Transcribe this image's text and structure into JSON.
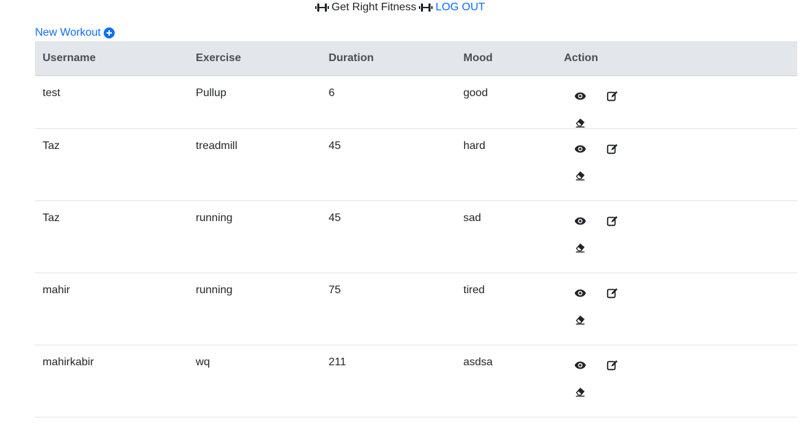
{
  "header": {
    "brand": "Get Right Fitness",
    "logout_label": "LOG OUT"
  },
  "toolbar": {
    "new_workout_label": "New Workout"
  },
  "table": {
    "columns": [
      "Username",
      "Exercise",
      "Duration",
      "Mood",
      "Action"
    ],
    "rows": [
      {
        "username": "test",
        "exercise": "Pullup",
        "duration": "6",
        "mood": "good"
      },
      {
        "username": "Taz",
        "exercise": "treadmill",
        "duration": "45",
        "mood": "hard"
      },
      {
        "username": "Taz",
        "exercise": "running",
        "duration": "45",
        "mood": "sad"
      },
      {
        "username": "mahir",
        "exercise": "running",
        "duration": "75",
        "mood": "tired"
      },
      {
        "username": "mahirkabir",
        "exercise": "wq",
        "duration": "211",
        "mood": "asdsa"
      }
    ]
  },
  "icons": {
    "brand": "dumbbell-icon",
    "new_workout": "plus-circle-icon",
    "view": "eye-icon",
    "edit": "edit-icon",
    "delete": "eraser-icon"
  },
  "colors": {
    "link": "#0d6efd",
    "table_header_bg": "#e3e6ea",
    "text": "#212529"
  }
}
